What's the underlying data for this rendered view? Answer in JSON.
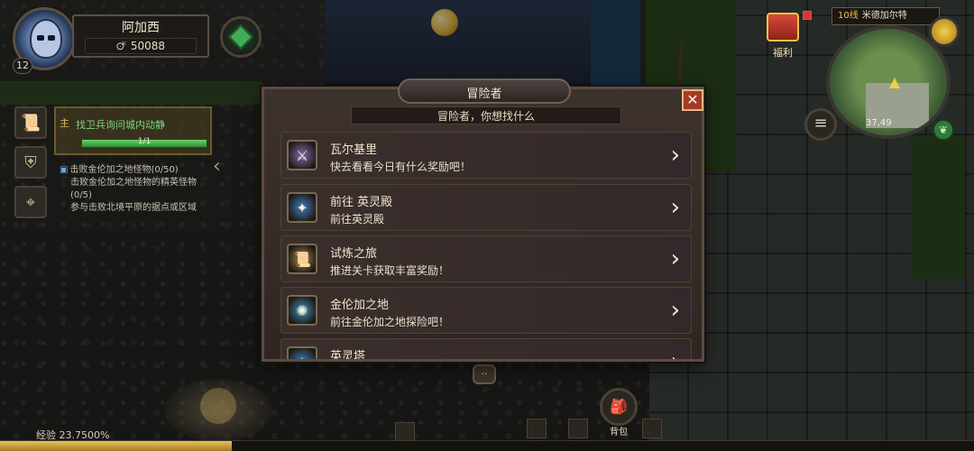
{
  "player": {
    "name": "阿加西",
    "level": "12",
    "gold": "50088"
  },
  "quest": {
    "main_title": "找卫兵询问城内动静",
    "progress_text": "1/1",
    "progress": 1.0,
    "details": [
      "击败金伦加之地怪物(0/50)",
      "击败金伦加之地怪物的精英怪物(0/5)",
      "参与击败北境平原的据点或区域"
    ]
  },
  "map": {
    "line": "10线",
    "location": "米德加尔特",
    "coords": "37,49",
    "gift_label": "福利"
  },
  "dialog": {
    "title": "冒险者",
    "subtitle": "冒险者，你想找什么",
    "close_label": "✕",
    "options": [
      {
        "title": "瓦尔基里",
        "desc": "快去看看今日有什么奖励吧！",
        "icon": "valkyrie-icon",
        "glyph": "⚔",
        "color": "#8a6ab0"
      },
      {
        "title": "前往 英灵殿",
        "desc": "前往英灵殿",
        "icon": "valhalla-icon",
        "glyph": "✦",
        "color": "#3f7fc0"
      },
      {
        "title": "试炼之旅",
        "desc": "推进关卡获取丰富奖励！",
        "icon": "scroll-icon",
        "glyph": "📜",
        "color": "#b08850"
      },
      {
        "title": "金伦加之地",
        "desc": "前往金伦加之地探险吧！",
        "icon": "portal-icon",
        "glyph": "✺",
        "color": "#3f8fc0"
      },
      {
        "title": "英灵塔",
        "desc": "",
        "icon": "tower-icon",
        "glyph": "✦",
        "color": "#3f7fc0"
      }
    ]
  },
  "hud": {
    "exp_label": "经验 23.7500%",
    "exp_progress": 0.2375,
    "bag_label": "背包",
    "chat_label": "··"
  },
  "colors": {
    "accent_gold": "#f0c14a",
    "close_red": "#a43a28",
    "quest_green": "#7fd37f"
  }
}
